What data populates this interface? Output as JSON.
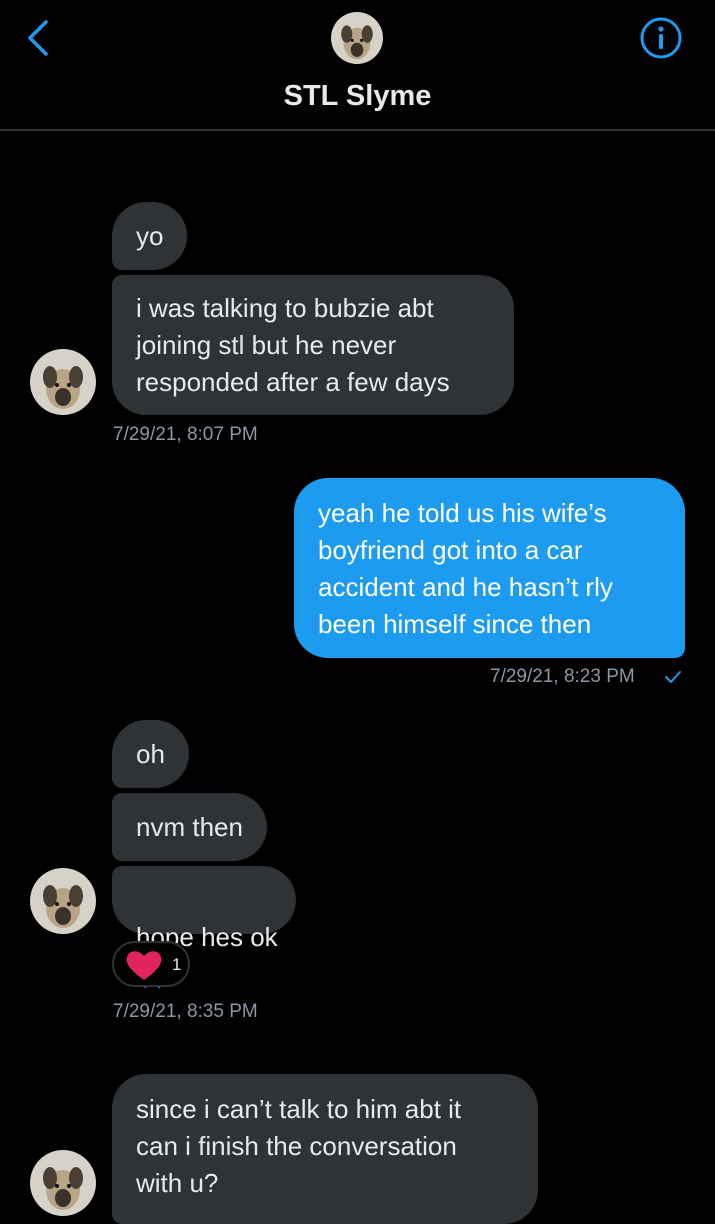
{
  "header": {
    "title": "STL Slyme",
    "back_icon": "chevron-left-icon",
    "info_icon": "info-circle-icon",
    "accent_color": "#1d9bf0"
  },
  "conversation": {
    "received_bubble_color": "#2f3336",
    "sent_bubble_color": "#1d9bf0",
    "messages": [
      {
        "direction": "received",
        "text": "yo"
      },
      {
        "direction": "received",
        "text": "i was talking to bubzie abt\njoining stl but he never\nresponded after a few days"
      },
      {
        "type": "timestamp",
        "text": "7/29/21, 8:07 PM"
      },
      {
        "direction": "sent",
        "text": "yeah he told us his wife’s\nboyfriend got into a car\naccident and he hasn’t rly\nbeen himself since then"
      },
      {
        "type": "timestamp",
        "text": "7/29/21, 8:23 PM",
        "status_icon": "check-icon"
      },
      {
        "direction": "received",
        "text": "oh"
      },
      {
        "direction": "received",
        "text": "nvm then"
      },
      {
        "direction": "received",
        "text": "hope hes ok",
        "emoji": "🙏"
      },
      {
        "type": "reaction",
        "icon": "heart-icon",
        "count": "1"
      },
      {
        "type": "timestamp",
        "text": "7/29/21, 8:35 PM"
      },
      {
        "direction": "received",
        "text": "since i can’t talk to him abt it\ncan i finish the conversation\nwith u?"
      }
    ]
  }
}
